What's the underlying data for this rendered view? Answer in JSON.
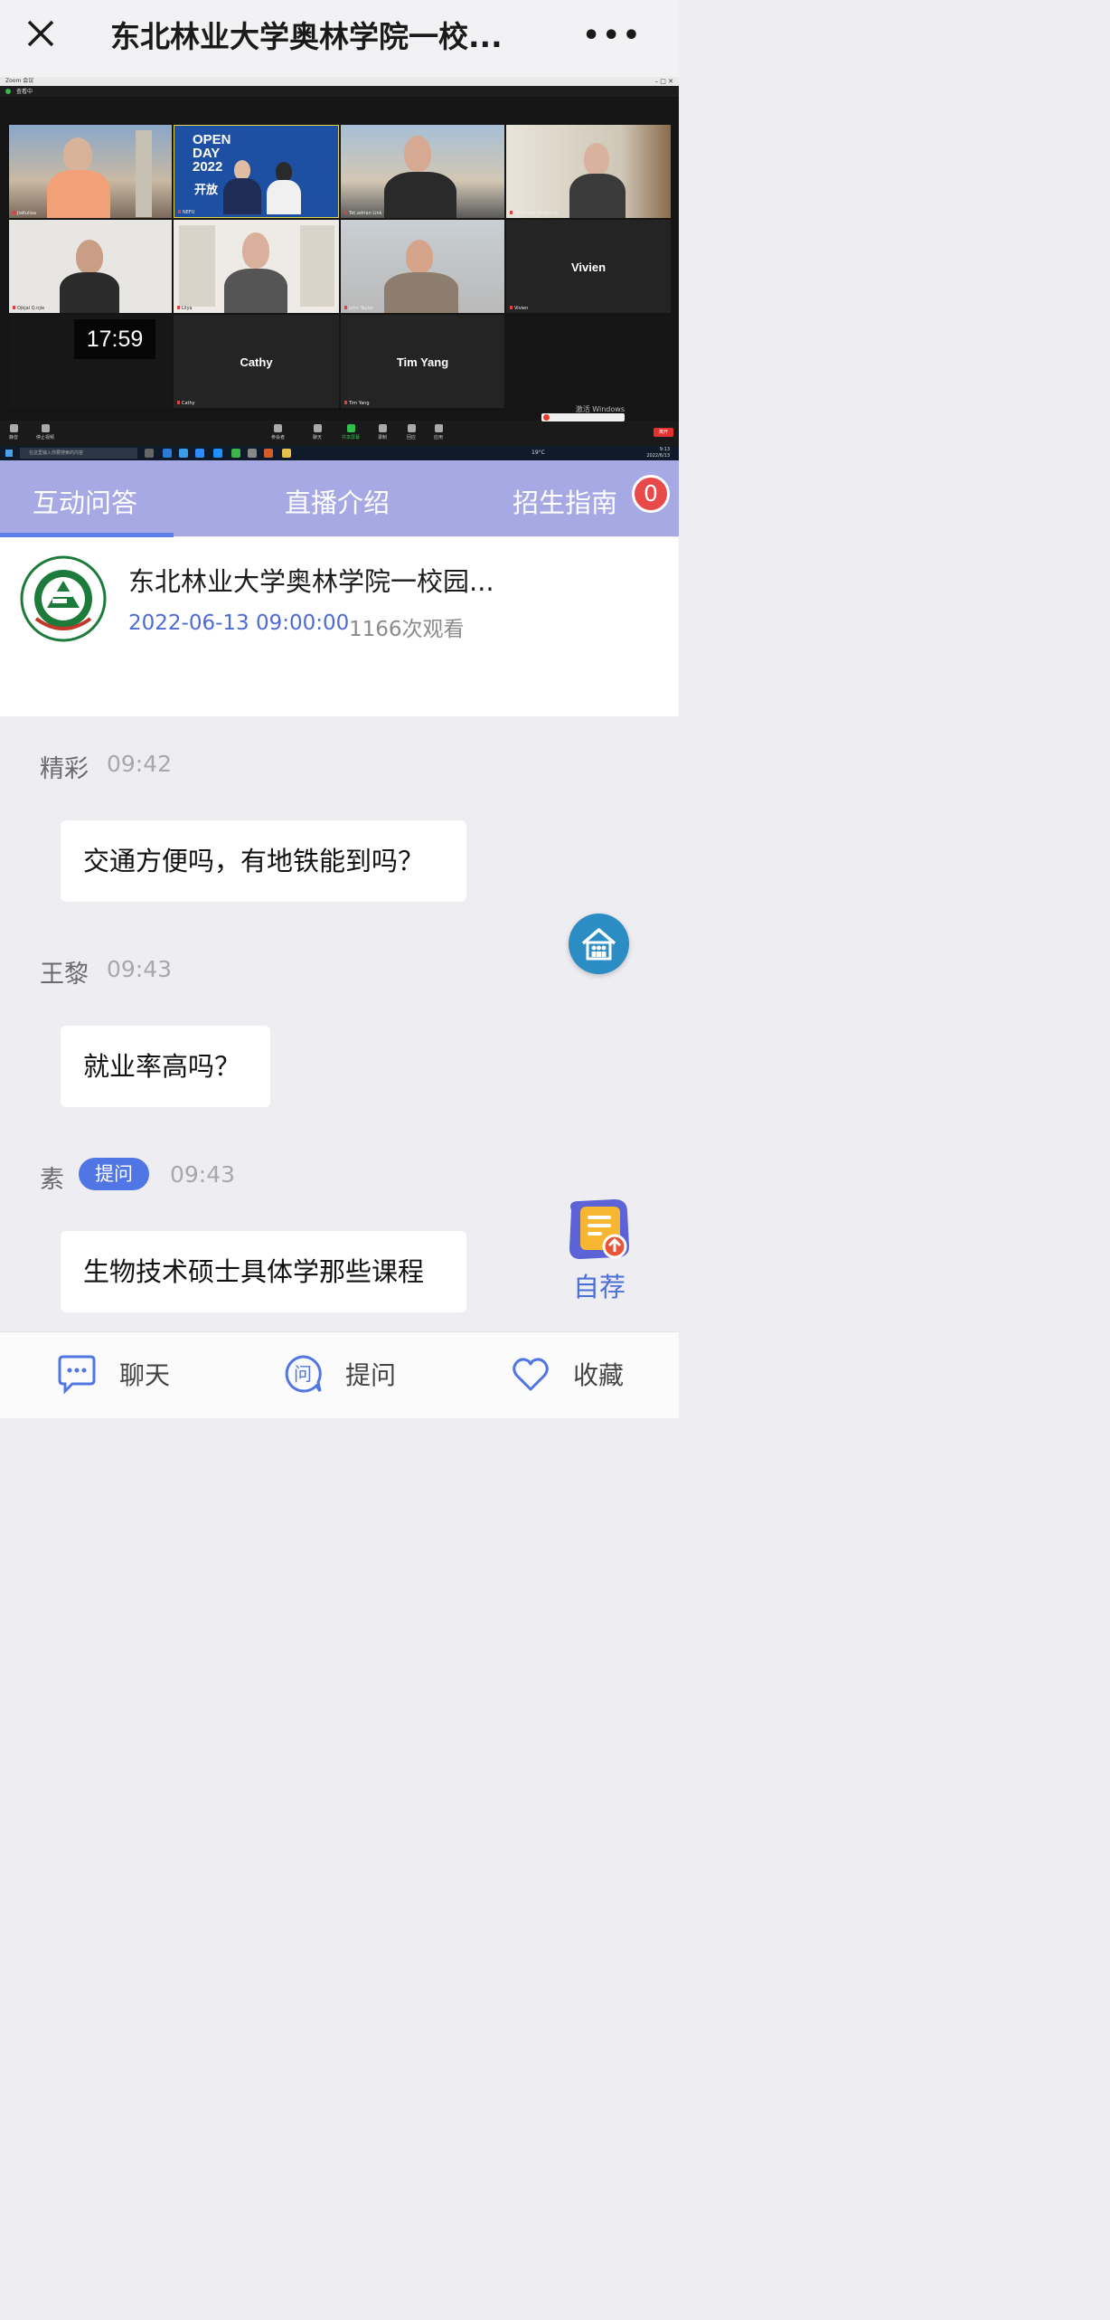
{
  "header": {
    "title": "东北林业大学奥林学院一校...",
    "close_icon": "close-icon",
    "more_label": "•••"
  },
  "video": {
    "zoom_title": "Zoom 会议",
    "view_label": "查看中",
    "window_controls": "–  □  ✕",
    "clock": "17:59",
    "tiles": [
      {
        "name": "JiaKuliaa",
        "big": ""
      },
      {
        "name": "NEFU",
        "big": ""
      },
      {
        "name": "Tet.adrian Link",
        "big": ""
      },
      {
        "name": "Bertlcock RA.ds4.ty",
        "big": ""
      },
      {
        "name": "Ojkjal Q.njie",
        "big": ""
      },
      {
        "name": "Lilya",
        "big": ""
      },
      {
        "name": "John Taylor",
        "big": ""
      },
      {
        "name": "Vivien",
        "big": "Vivien"
      },
      {
        "name": "Cathy",
        "big": "Cathy"
      },
      {
        "name": "Tim Yang",
        "big": "Tim Yang"
      }
    ],
    "toolbar": {
      "mute": "静音",
      "stop_video": "停止视频",
      "participants": "参会者",
      "chat": "聊天",
      "share": "共享屏幕",
      "record": "录制",
      "reactions": "回应",
      "apps": "应用",
      "end": "离开"
    },
    "activate_windows": "激活 Windows",
    "taskbar_search": "在这里输入你要搜索的内容",
    "taskbar_temp": "19°C",
    "taskbar_time": "9:13",
    "taskbar_date": "2022/6/13",
    "open_day_text": "OPEN DAY 2022",
    "open_day_cn": "开放"
  },
  "tabs": [
    {
      "label": "互动问答"
    },
    {
      "label": "直播介绍"
    },
    {
      "label": "招生指南"
    }
  ],
  "badge_count": "0",
  "info": {
    "title": "东北林业大学奥林学院一校园...",
    "date": "2022-06-13 09:00:00",
    "views": "1166次观看",
    "logo_text": "NORTHEAST FORESTRY UNIVERSITY",
    "logo_year": "1952"
  },
  "messages": [
    {
      "user": "精彩",
      "time": "09:42",
      "text": "交通方便吗，有地铁能到吗？"
    },
    {
      "user": "王黎",
      "time": "09:43",
      "text": "就业率高吗？"
    },
    {
      "user": "素",
      "tag": "提问",
      "time": "09:43",
      "text": "生物技术硕士具体学那些课程"
    }
  ],
  "floating": {
    "recommend_label": "自荐"
  },
  "bottom_bar": [
    {
      "label": "聊天",
      "icon": "chat-icon"
    },
    {
      "label": "提问",
      "icon": "question-icon"
    },
    {
      "label": "收藏",
      "icon": "heart-icon"
    }
  ],
  "colors": {
    "tab_bar": "#a7a9e4",
    "accent": "#5075e4",
    "badge": "#e84a4a"
  }
}
